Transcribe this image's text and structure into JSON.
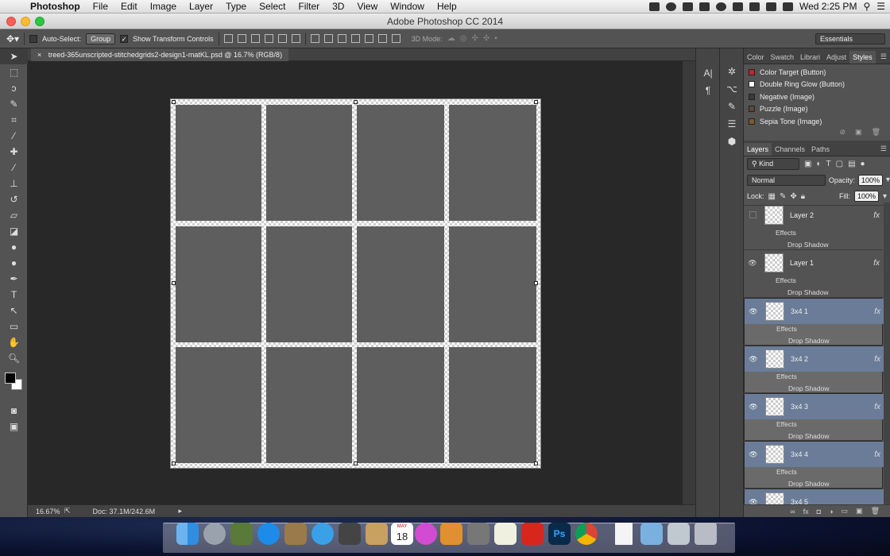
{
  "menubar": {
    "app": "Photoshop",
    "items": [
      "File",
      "Edit",
      "Image",
      "Layer",
      "Type",
      "Select",
      "Filter",
      "3D",
      "View",
      "Window",
      "Help"
    ],
    "clock": "Wed 2:25 PM"
  },
  "window": {
    "title": "Adobe Photoshop CC 2014"
  },
  "options": {
    "auto_select_label": "Auto-Select:",
    "auto_select_value": "Group",
    "transform_label": "Show Transform Controls",
    "mode_3d_label": "3D Mode:",
    "workspace": "Essentials"
  },
  "document": {
    "tab_title": "treed-365unscripted-stitchedgrids2-design1-matKL.psd @ 16.7% (RGB/8)"
  },
  "status": {
    "zoom": "16.67%",
    "doc": "Doc: 37.1M/242.6M"
  },
  "styles_panel": {
    "tabs": [
      "Color",
      "Swatch",
      "Librari",
      "Adjust",
      "Styles"
    ],
    "items": [
      {
        "name": "Color Target (Button)",
        "color": "#c0272d"
      },
      {
        "name": "Double Ring Glow (Button)",
        "color": "#ffffff"
      },
      {
        "name": "Negative (Image)",
        "color": "#3a3a3a"
      },
      {
        "name": "Puzzle (Image)",
        "color": "#5a4a3a"
      },
      {
        "name": "Sepia Tone (Image)",
        "color": "#7a5a30"
      }
    ]
  },
  "layers_panel": {
    "tabs": [
      "Layers",
      "Channels",
      "Paths"
    ],
    "kind": "Kind",
    "blend": "Normal",
    "opacity_label": "Opacity:",
    "opacity": "100%",
    "lock_label": "Lock:",
    "fill_label": "Fill:",
    "fill": "100%",
    "effects_label": "Effects",
    "shadow_label": "Drop Shadow",
    "layers": [
      {
        "name": "Layer 2",
        "selected": false
      },
      {
        "name": "Layer 1",
        "selected": false
      },
      {
        "name": "3x4 1",
        "selected": true
      },
      {
        "name": "3x4 2",
        "selected": true
      },
      {
        "name": "3x4 3",
        "selected": true
      },
      {
        "name": "3x4 4",
        "selected": true
      },
      {
        "name": "3x4 5",
        "selected": true
      }
    ]
  },
  "dock": {
    "calendar_month": "MAY",
    "calendar_day": "18"
  }
}
